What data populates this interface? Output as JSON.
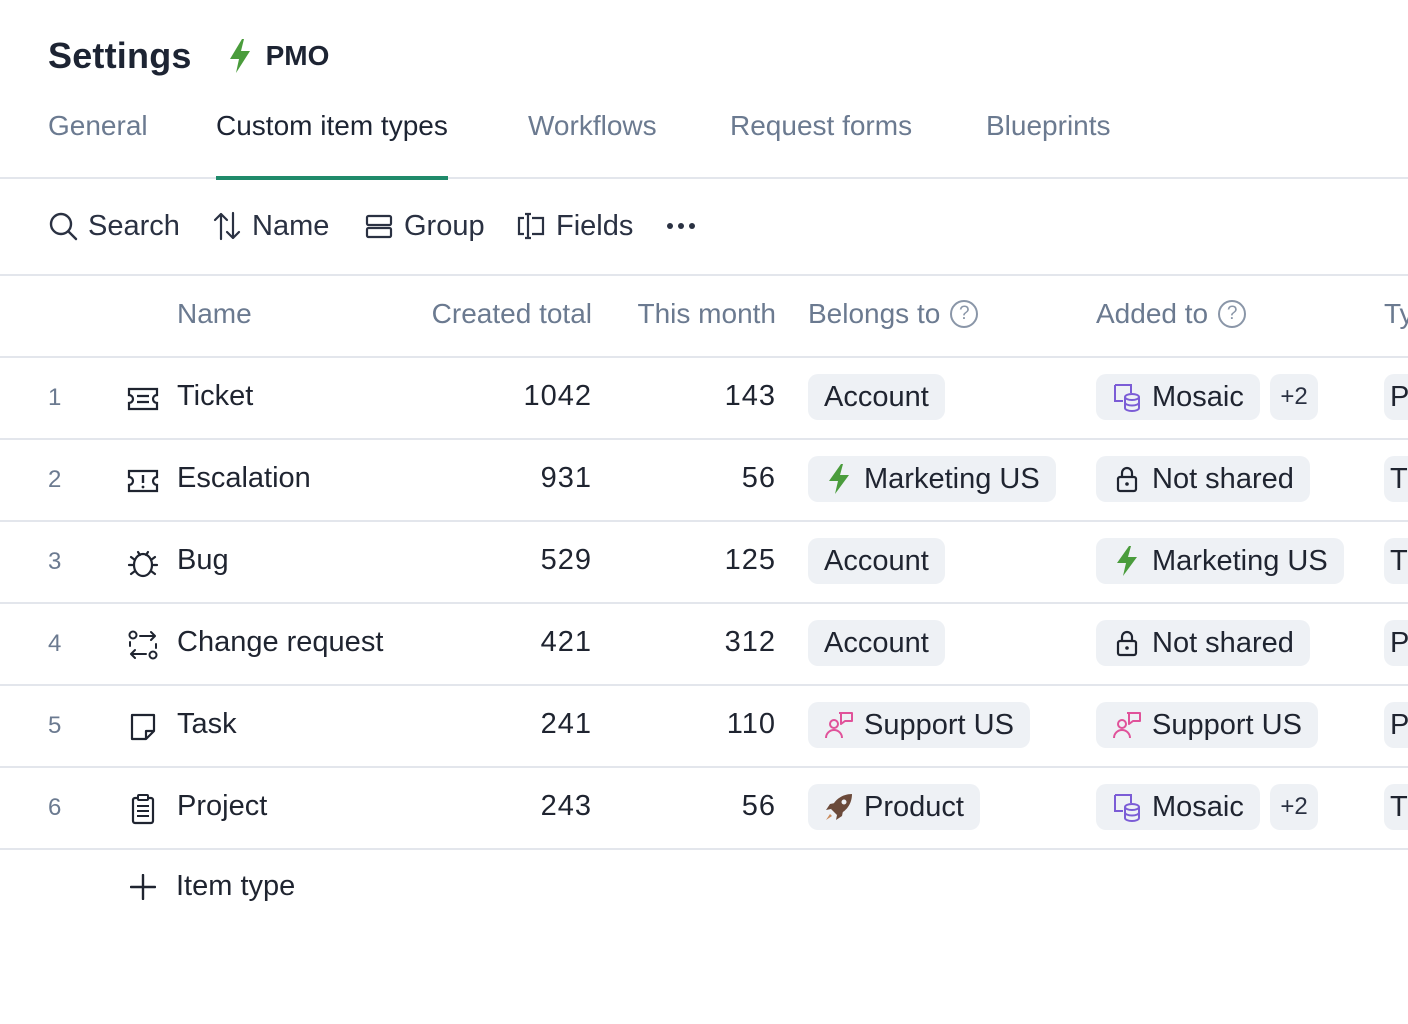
{
  "header": {
    "title": "Settings",
    "workspace": "PMO"
  },
  "tabs": [
    {
      "label": "General"
    },
    {
      "label": "Custom item types",
      "active": true
    },
    {
      "label": "Workflows"
    },
    {
      "label": "Request forms"
    },
    {
      "label": "Blueprints"
    }
  ],
  "toolbar": {
    "search": "Search",
    "sort": "Name",
    "group": "Group",
    "fields": "Fields"
  },
  "columns": {
    "name": "Name",
    "created_total": "Created total",
    "this_month": "This month",
    "belongs_to": "Belongs to",
    "added_to": "Added to",
    "type_partial": "Ty",
    "help_glyph": "?"
  },
  "rows": [
    {
      "num": "1",
      "icon": "ticket-icon",
      "name": "Ticket",
      "created_total": "1042",
      "this_month": "143",
      "belongs_to": "Account",
      "added_to": "Mosaic",
      "added_extra": "+2",
      "type_partial": "P"
    },
    {
      "num": "2",
      "icon": "escalation-icon",
      "name": "Escalation",
      "created_total": "931",
      "this_month": "56",
      "belongs_to": "Marketing US",
      "added_to": "Not shared",
      "type_partial": "T"
    },
    {
      "num": "3",
      "icon": "bug-icon",
      "name": "Bug",
      "created_total": "529",
      "this_month": "125",
      "belongs_to": "Account",
      "added_to": "Marketing US",
      "type_partial": "T"
    },
    {
      "num": "4",
      "icon": "change-request-icon",
      "name": "Change request",
      "created_total": "421",
      "this_month": "312",
      "belongs_to": "Account",
      "added_to": "Not shared",
      "type_partial": "P"
    },
    {
      "num": "5",
      "icon": "task-icon",
      "name": "Task",
      "created_total": "241",
      "this_month": "110",
      "belongs_to": "Support US",
      "added_to": "Support US",
      "type_partial": "P"
    },
    {
      "num": "6",
      "icon": "project-icon",
      "name": "Project",
      "created_total": "243",
      "this_month": "56",
      "belongs_to": "Product",
      "added_to": "Mosaic",
      "added_extra": "+2",
      "type_partial": "T"
    }
  ],
  "add_row": "Item type",
  "colors": {
    "accent": "#1f8a6a",
    "bolt": "#4a9c3c",
    "support": "#e0529a",
    "mosaic": "#7b5cd6",
    "product": "#6b4a3a"
  }
}
